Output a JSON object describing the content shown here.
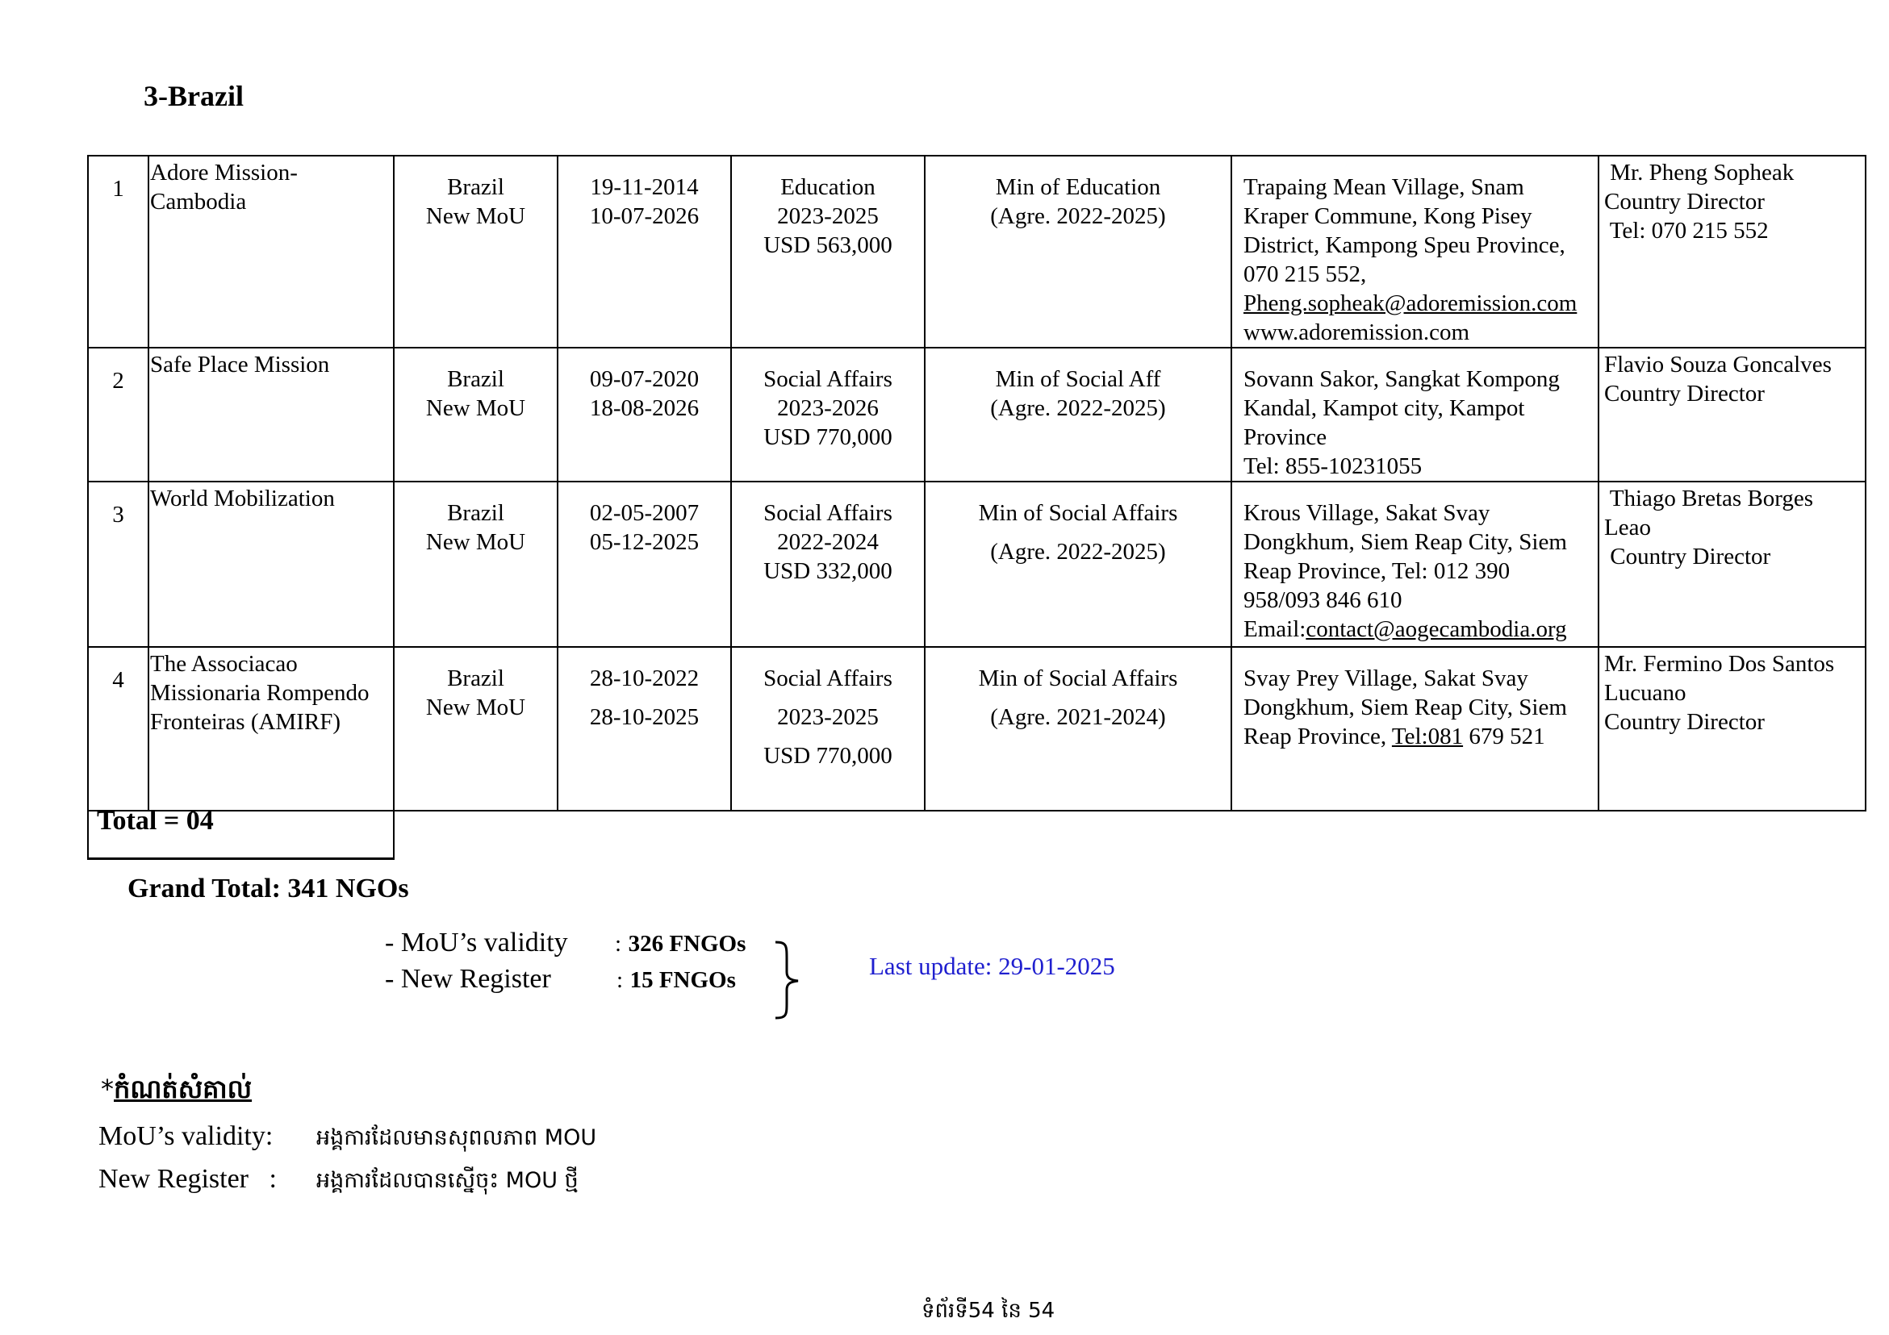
{
  "section_title": "3-Brazil",
  "rows": [
    {
      "no": "1",
      "name": [
        "Adore Mission-",
        "Cambodia"
      ],
      "country": [
        "Brazil",
        "New MoU"
      ],
      "dates": [
        "19-11-2014",
        "10-07-2026"
      ],
      "sector": [
        "Education",
        "2023-2025",
        "USD 563,000"
      ],
      "ministry": [
        "Min of Education",
        "(Agre. 2022-2025)"
      ],
      "address": [
        "Trapaing Mean Village, Snam",
        "Kraper Commune, Kong Pisey",
        "District, Kampong Speu Province,",
        "070 215 552,"
      ],
      "address_email": "Pheng.sopheak@adoremission.com",
      "address_web": "www.adoremission.com",
      "contact": [
        " Mr. Pheng Sopheak",
        "Country Director",
        " Tel: 070 215 552"
      ]
    },
    {
      "no": "2",
      "name": [
        "Safe Place Mission"
      ],
      "country": [
        "Brazil",
        "New MoU"
      ],
      "dates": [
        "09-07-2020",
        "18-08-2026"
      ],
      "sector": [
        "Social Affairs",
        "2023-2026",
        "USD 770,000"
      ],
      "ministry": [
        "Min of Social Aff",
        "(Agre. 2022-2025)"
      ],
      "address": [
        "Sovann Sakor, Sangkat Kompong",
        "Kandal, Kampot city, Kampot",
        "Province",
        "Tel: 855-10231055"
      ],
      "contact": [
        "Flavio Souza Goncalves",
        "Country Director"
      ]
    },
    {
      "no": "3",
      "name": [
        "World Mobilization"
      ],
      "country": [
        "Brazil",
        "New MoU"
      ],
      "dates": [
        "02-05-2007",
        "05-12-2025"
      ],
      "sector": [
        "Social Affairs",
        "2022-2024",
        "USD 332,000"
      ],
      "ministry": [
        "Min of Social Affairs",
        "(Agre. 2022-2025)"
      ],
      "address": [
        "Krous Village, Sakat Svay",
        "Dongkhum, Siem Reap City, Siem",
        "Reap Province, Tel: 012 390",
        "958/093 846 610"
      ],
      "address_email_label": "Email:",
      "address_email": "contact@aogecambodia.org",
      "contact": [
        " Thiago Bretas Borges",
        "Leao",
        " Country Director"
      ]
    },
    {
      "no": "4",
      "name": [
        "The Associacao",
        "Missionaria Rompendo",
        "Fronteiras (AMIRF)"
      ],
      "country": [
        "Brazil",
        "New MoU"
      ],
      "dates": [
        "28-10-2022",
        "28-10-2025"
      ],
      "sector": [
        "Social Affairs",
        "2023-2025",
        "USD 770,000"
      ],
      "ministry": [
        "Min of Social Affairs",
        "(Agre. 2021-2024)"
      ],
      "address": [
        "Svay Prey Village, Sakat Svay",
        "Dongkhum, Siem Reap City, Siem"
      ],
      "address_last_prefix": "Reap Province, ",
      "address_last_link": "Tel:081",
      "address_last_suffix": " 679 521",
      "contact": [
        "Mr. Fermino Dos Santos",
        "Lucuano",
        "Country Director"
      ]
    }
  ],
  "total": "Total = 04",
  "grand_total": "Grand Total: 341 NGOs",
  "summary": [
    {
      "label": "- MoU’s validity",
      "sep": ":",
      "value": "326 FNGOs"
    },
    {
      "label": "- New Register",
      "sep": ":",
      "value": "15 FNGOs"
    }
  ],
  "last_update": "Last update: 29-01-2025",
  "last_update_color": "#1f1fcf",
  "note": {
    "star": "*",
    "heading": "កំណត់សំគាល់",
    "lines": [
      {
        "term": "MoU’s validity:",
        "desc": "អង្គការដែលមានសុពលភាព MOU"
      },
      {
        "term": "New Register   :",
        "desc": "អង្គការដែលបានស្នើចុះ MOU ថ្មី"
      }
    ]
  },
  "footer": "ទំព័រទី54 នៃ 54"
}
